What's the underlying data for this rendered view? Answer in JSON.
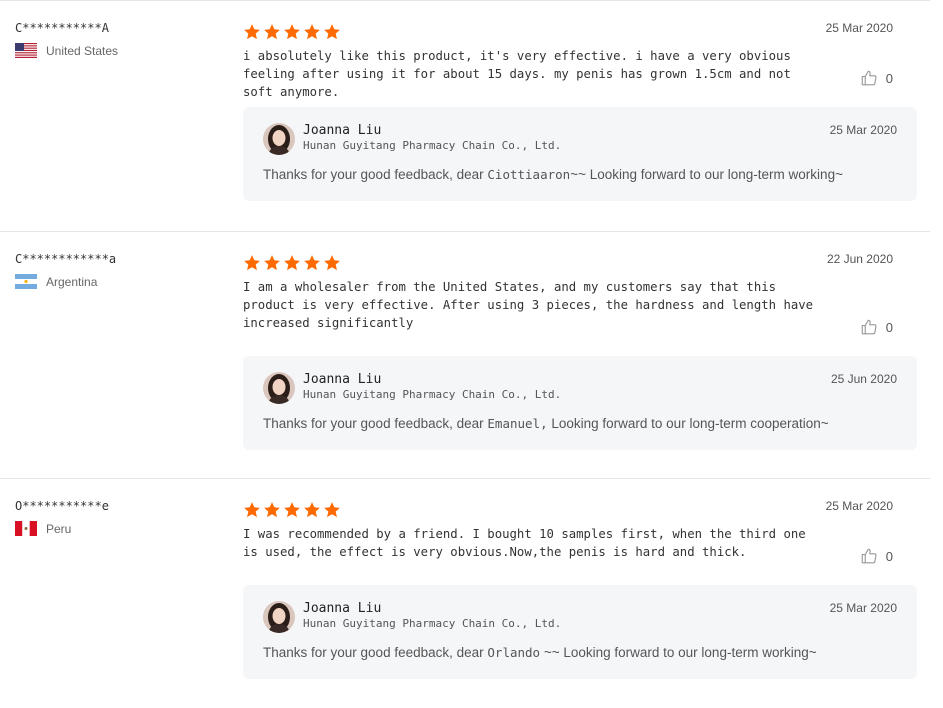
{
  "reviews": [
    {
      "user": "C***********A",
      "country": "United States",
      "flag_icon": "us-flag-icon",
      "rating": 5,
      "date": "25 Mar 2020",
      "text": "i absolutely like this product, it's very effective. i have a very obvious feeling after using it for about 15 days. my penis has grown 1.5cm and not soft anymore.",
      "likes": "0",
      "reply": {
        "name": "Joanna Liu",
        "company": "Hunan Guyitang Pharmacy Chain Co., Ltd.",
        "date": "25 Mar 2020",
        "text_before": "Thanks for your good feedback, dear ",
        "buyer": "Ciottiaaron",
        "text_after": "~~ Looking forward to our long-term working~"
      }
    },
    {
      "user": "C************a",
      "country": "Argentina",
      "flag_icon": "argentina-flag-icon",
      "rating": 5,
      "date": "22 Jun 2020",
      "text": "I am a wholesaler from the United States, and my customers say that this product is very effective. After using 3 pieces, the hardness and length have increased significantly",
      "likes": "0",
      "reply": {
        "name": "Joanna Liu",
        "company": "Hunan Guyitang Pharmacy Chain Co., Ltd.",
        "date": "25 Jun 2020",
        "text_before": "Thanks for your good feedback, dear ",
        "buyer": "Emanuel,",
        "text_after": " Looking forward to our long-term cooperation~"
      }
    },
    {
      "user": "O***********e",
      "country": "Peru",
      "flag_icon": "peru-flag-icon",
      "rating": 5,
      "date": "25 Mar 2020",
      "text": "I was recommended by a friend. I bought 10 samples first, when the third one is used, the effect is very obvious.Now,the penis is hard and thick.",
      "likes": "0",
      "reply": {
        "name": "Joanna Liu",
        "company": "Hunan Guyitang Pharmacy Chain Co., Ltd.",
        "date": "25 Mar 2020",
        "text_before": "Thanks for your good feedback, dear ",
        "buyer": "Orlando",
        "text_after": " ~~ Looking forward to our long-term working~"
      }
    }
  ],
  "colors": {
    "star": "#ff6a00",
    "reply_bg": "#f5f6f8",
    "divider": "#e5e5e5"
  }
}
